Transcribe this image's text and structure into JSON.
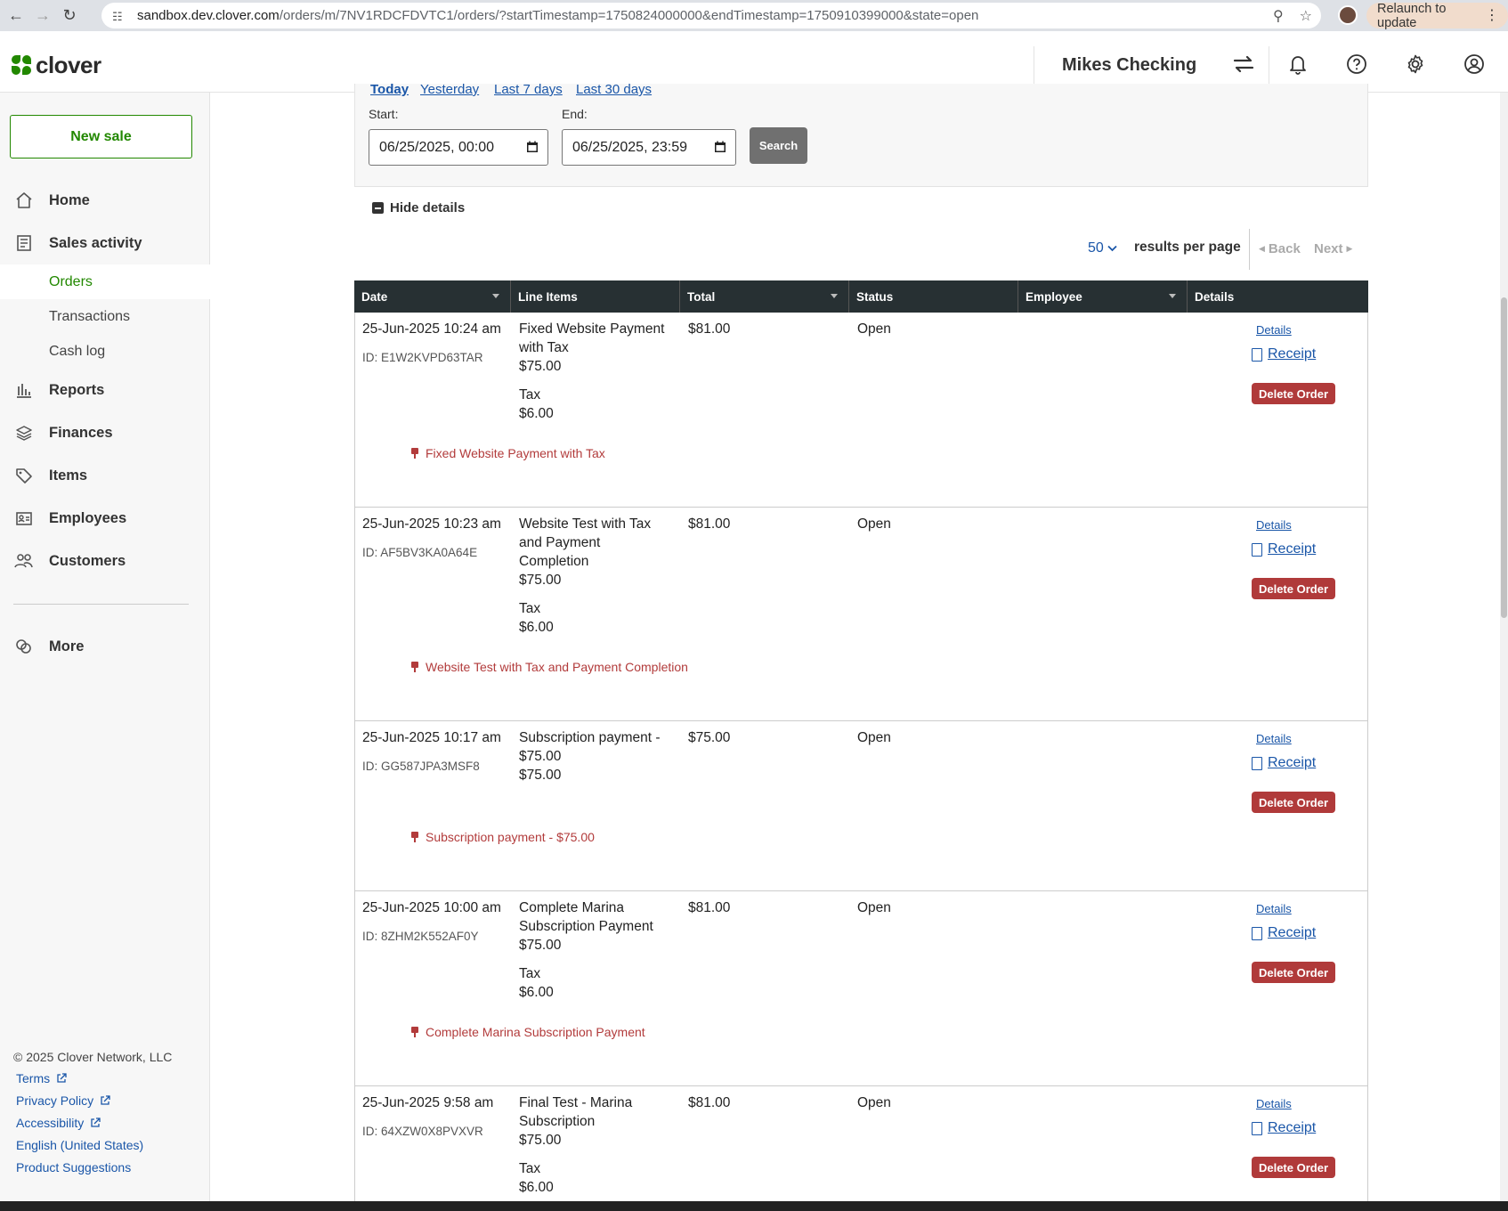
{
  "browser": {
    "url_host": "sandbox.dev.clover.com",
    "url_path": "/orders/m/7NV1RDCFDVTC1/orders/?startTimestamp=1750824000000&endTimestamp=1750910399000&state=open",
    "relaunch_label": "Relaunch to update"
  },
  "header": {
    "logo_text": "clover",
    "merchant_name": "Mikes Checking"
  },
  "sidebar": {
    "new_sale_label": "New sale",
    "items": [
      {
        "label": "Home",
        "icon": "home-icon"
      },
      {
        "label": "Sales activity",
        "icon": "receipt-icon"
      },
      {
        "label": "Reports",
        "icon": "bar-chart-icon"
      },
      {
        "label": "Finances",
        "icon": "layers-icon"
      },
      {
        "label": "Items",
        "icon": "tag-icon"
      },
      {
        "label": "Employees",
        "icon": "id-card-icon"
      },
      {
        "label": "Customers",
        "icon": "people-icon"
      },
      {
        "label": "More",
        "icon": "more-icon"
      }
    ],
    "subitems": [
      {
        "label": "Orders",
        "active": true
      },
      {
        "label": "Transactions",
        "active": false
      },
      {
        "label": "Cash log",
        "active": false
      }
    ],
    "footer": {
      "copyright": "© 2025 Clover Network, LLC",
      "links": [
        "Terms",
        "Privacy Policy",
        "Accessibility",
        "English (United States)",
        "Product Suggestions"
      ]
    }
  },
  "filters": {
    "quick_links": [
      "Today",
      "Yesterday",
      "Last 7 days",
      "Last 30 days"
    ],
    "start_label": "Start:",
    "start_value": "06/25/2025, 00:00",
    "end_label": "End:",
    "end_value": "06/25/2025, 23:59",
    "search_label": "Search",
    "hide_details_label": "Hide details"
  },
  "pagination": {
    "per_page_value": "50",
    "per_page_label": "results per page",
    "back_label": "Back",
    "next_label": "Next"
  },
  "table": {
    "columns": [
      "Date",
      "Line Items",
      "Total",
      "Status",
      "Employee",
      "Details"
    ],
    "details_label": "Details",
    "receipt_label": "Receipt",
    "delete_label": "Delete Order",
    "rows": [
      {
        "date": "25-Jun-2025 10:24 am",
        "id": "ID: E1W2KVPD63TAR",
        "item_name": [
          "Fixed Website Payment",
          "with Tax"
        ],
        "item_price": "$75.00",
        "tax_label": "Tax",
        "tax_amount": "$6.00",
        "total": "$81.00",
        "status": "Open",
        "note": "Fixed Website Payment with Tax"
      },
      {
        "date": "25-Jun-2025 10:23 am",
        "id": "ID: AF5BV3KA0A64E",
        "item_name": [
          "Website Test with Tax",
          "and Payment",
          "Completion"
        ],
        "item_price": "$75.00",
        "tax_label": "Tax",
        "tax_amount": "$6.00",
        "total": "$81.00",
        "status": "Open",
        "note": "Website Test with Tax and Payment Completion"
      },
      {
        "date": "25-Jun-2025 10:17 am",
        "id": "ID: GG587JPA3MSF8",
        "item_name": [
          "Subscription payment -",
          "$75.00"
        ],
        "item_price": "$75.00",
        "tax_label": "",
        "tax_amount": "",
        "total": "$75.00",
        "status": "Open",
        "note": "Subscription payment - $75.00"
      },
      {
        "date": "25-Jun-2025 10:00 am",
        "id": "ID: 8ZHM2K552AF0Y",
        "item_name": [
          "Complete Marina",
          "Subscription Payment"
        ],
        "item_price": "$75.00",
        "tax_label": "Tax",
        "tax_amount": "$6.00",
        "total": "$81.00",
        "status": "Open",
        "note": "Complete Marina Subscription Payment"
      },
      {
        "date": "25-Jun-2025 9:58 am",
        "id": "ID: 64XZW0X8PVXVR",
        "item_name": [
          "Final Test - Marina",
          "Subscription"
        ],
        "item_price": "$75.00",
        "tax_label": "Tax",
        "tax_amount": "$6.00",
        "total": "$81.00",
        "status": "Open",
        "note": ""
      }
    ]
  },
  "colors": {
    "brand_green": "#228800",
    "link_blue": "#1a56a8",
    "delete_red": "#b03a3a",
    "table_header": "#273033"
  }
}
